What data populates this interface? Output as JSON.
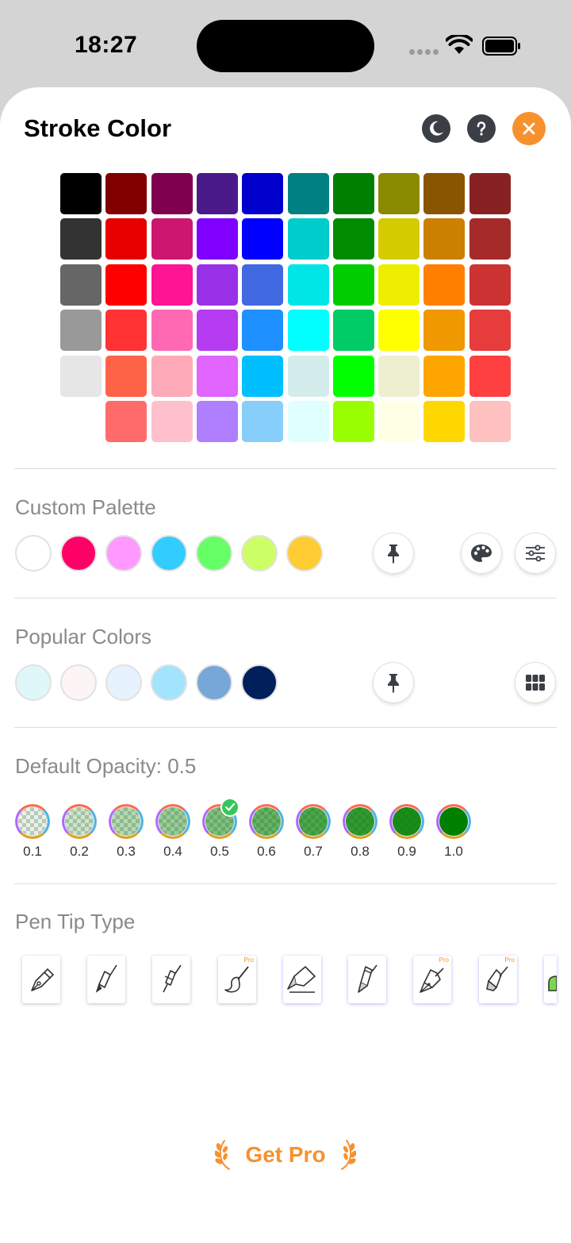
{
  "status_bar": {
    "time": "18:27"
  },
  "header": {
    "title": "Stroke Color"
  },
  "colors": {
    "accent": "#f7912e",
    "header_button": "#3a3e45",
    "check": "#34c759"
  },
  "color_grid": [
    [
      "#000000",
      "#333333",
      "#666666",
      "#999999",
      "#e6e6e6",
      null
    ],
    [
      "#800000",
      "#e60000",
      "#ff0000",
      "#ff3333",
      "#ff6347",
      "#ff6b6b"
    ],
    [
      "#800050",
      "#cc1670",
      "#ff1493",
      "#ff69b4",
      "#ffaab8",
      "#ffc0cb"
    ],
    [
      "#4b1a8a",
      "#8000ff",
      "#9932e6",
      "#b53cf0",
      "#e066ff",
      "#b07fff"
    ],
    [
      "#0000cc",
      "#0000ff",
      "#4169e1",
      "#1e90ff",
      "#00bfff",
      "#87cefa"
    ],
    [
      "#008080",
      "#00cccc",
      "#00e5e5",
      "#00ffff",
      "#d4ecec",
      "#e0ffff"
    ],
    [
      "#008000",
      "#008c00",
      "#00cc00",
      "#00cc66",
      "#00ff00",
      "#99ff00"
    ],
    [
      "#8a8a00",
      "#d4cc00",
      "#eeee00",
      "#ffff00",
      "#eeeed0",
      "#ffffe6"
    ],
    [
      "#8a5500",
      "#cc8000",
      "#ff8000",
      "#f09800",
      "#ffa500",
      "#ffd700"
    ],
    [
      "#882222",
      "#a52a2a",
      "#cc3333",
      "#e63c3c",
      "#ff4040",
      "#ffc0c0"
    ]
  ],
  "custom_palette": {
    "label": "Custom Palette",
    "colors": [
      "#ffffff",
      "#ff0066",
      "#ff99ff",
      "#33ccff",
      "#66ff66",
      "#ccff66",
      "#ffcc33"
    ]
  },
  "popular_colors": {
    "label": "Popular Colors",
    "colors": [
      "#e0f7fa",
      "#fdf5f5",
      "#e6f2fd",
      "#a2e4fd",
      "#77a6d8",
      "#001f5b"
    ]
  },
  "opacity": {
    "label": "Default Opacity: 0.5",
    "selected": "0.5",
    "values": [
      "0.1",
      "0.2",
      "0.3",
      "0.4",
      "0.5",
      "0.6",
      "0.7",
      "0.8",
      "0.9",
      "1.0"
    ],
    "color": "#008000"
  },
  "pen_tips": {
    "label": "Pen Tip Type",
    "items": [
      {
        "icon": "fountain-pen-icon",
        "pro": ""
      },
      {
        "icon": "brush-pen-icon",
        "pro": ""
      },
      {
        "icon": "fine-liner-icon",
        "pro": ""
      },
      {
        "icon": "paint-brush-icon",
        "pro": "Pro"
      },
      {
        "icon": "chisel-marker-icon",
        "pro": ""
      },
      {
        "icon": "calligraphy-pen-icon",
        "pro": ""
      },
      {
        "icon": "nib-pen-icon",
        "pro": "Pro"
      },
      {
        "icon": "highlighter-icon",
        "pro": "Pro"
      }
    ]
  },
  "footer": {
    "get_pro_label": "Get Pro"
  }
}
